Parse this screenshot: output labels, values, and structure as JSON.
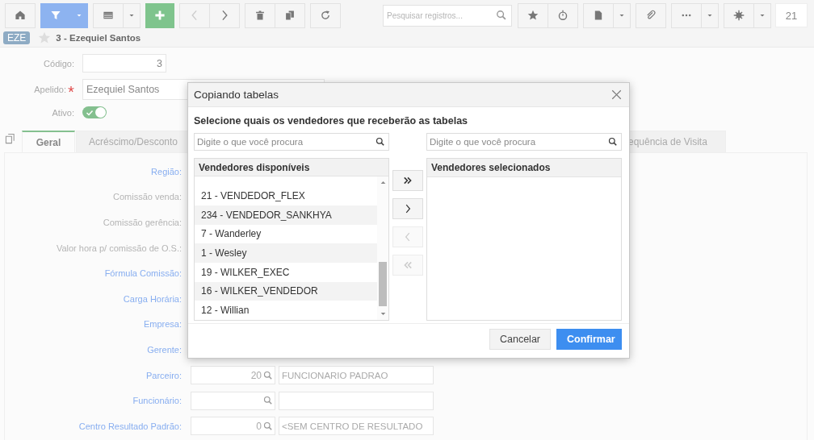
{
  "toolbar": {
    "filter_active": true,
    "search": {
      "placeholder": "Pesquisar registros..."
    },
    "counter": "21"
  },
  "record": {
    "badge": "EZE",
    "favorite": false,
    "title": "3 - Ezequiel Santos"
  },
  "form": {
    "fields": [
      {
        "label": "Código:",
        "value": "3"
      },
      {
        "label": "Apelido:",
        "required": true,
        "value": "Ezequiel Santos"
      }
    ],
    "active": {
      "label": "Ativo:",
      "on": true
    }
  },
  "tabs": [
    {
      "label": "Geral",
      "selected": true
    },
    {
      "label": "Acréscimo/Desconto",
      "selected": false
    },
    {
      "label": "equência de Visita",
      "selected": false
    }
  ],
  "panel_rows": [
    {
      "label": "Região:",
      "link": true,
      "kind": "hidden"
    },
    {
      "label": "Comissão venda:",
      "link": false,
      "kind": "hidden"
    },
    {
      "label": "Comissão gerência:",
      "link": false,
      "kind": "hidden"
    },
    {
      "label": "Valor hora p/ comissão de O.S.:",
      "link": false,
      "kind": "hidden"
    },
    {
      "label": "Fórmula Comissão:",
      "link": true,
      "kind": "hidden"
    },
    {
      "label": "Carga Horária:",
      "link": true,
      "kind": "hidden"
    },
    {
      "label": "Empresa:",
      "link": true,
      "kind": "hidden"
    },
    {
      "label": "Gerente:",
      "link": true,
      "kind": "hidden"
    },
    {
      "label": "Parceiro:",
      "link": true,
      "kind": "lookup",
      "code": "20",
      "description": "FUNCIONARIO PADRAO"
    },
    {
      "label": "Funcionário:",
      "link": true,
      "kind": "lookup"
    },
    {
      "label": "Centro Resultado Padrão:",
      "link": true,
      "kind": "lookup",
      "code": "0",
      "description": "<SEM CENTRO DE RESULTADO"
    }
  ],
  "dialog": {
    "title": "Copiando tabelas",
    "subtitle": "Selecione quais os vendedores que receberão as tabelas",
    "available": {
      "search_placeholder": "Digite o que você procura",
      "header": "Vendedores disponíveis",
      "items": [
        "21 - VENDEDOR_FLEX",
        "234 - VENDEDOR_SANKHYA",
        "7 - Wanderley",
        "1 - Wesley",
        "19 - WILKER_EXEC",
        "16 - WILKER_VENDEDOR",
        "12 - Willian"
      ]
    },
    "selected": {
      "search_placeholder": "Digite o que você procura",
      "header": "Vendedores selecionados"
    },
    "transfer_buttons": [
      {
        "kind": "all-right",
        "disabled": false
      },
      {
        "kind": "right",
        "disabled": false
      },
      {
        "kind": "left",
        "disabled": true
      },
      {
        "kind": "all-left",
        "disabled": true
      }
    ],
    "buttons": [
      {
        "label": "Cancelar",
        "kind": "secondary"
      },
      {
        "label": "Confirmar",
        "kind": "primary"
      }
    ]
  }
}
